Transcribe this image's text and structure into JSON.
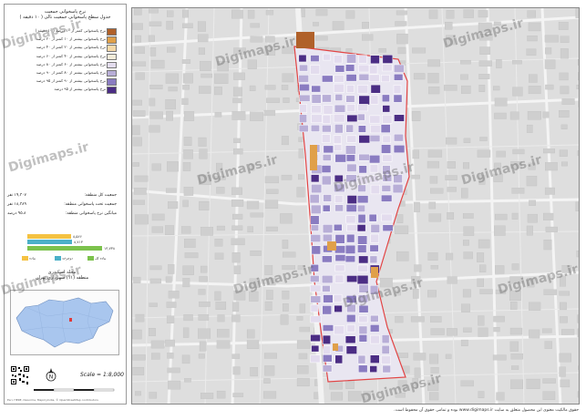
{
  "panel": {
    "title_line1": "نرخ پاسخوانی جمعیت",
    "title_line2": "جدول سطح پاسخوانی جمعیت نالی ( ۱۰ دقیقه )"
  },
  "legend": [
    {
      "label": "نرخ پاسخوانی کمتر از ۱۰ درصد ( ۱۰ دقیقه )",
      "color": "#b0612a"
    },
    {
      "label": "نرخ پاسخوانی بیشتر از ۱۰ کمتر از ۲۰ درصد",
      "color": "#e0a04a"
    },
    {
      "label": "نرخ پاسخوانی بیشتر از ۲۰ کمتر از ۴۰ درصد",
      "color": "#f5d9a8"
    },
    {
      "label": "نرخ پاسخوانی بیشتر از ۴۰ کمتر از ۶۰ درصد",
      "color": "#f3ecd9"
    },
    {
      "label": "نرخ پاسخوانی بیشتر از ۶۰ کمتر از ۸۰ درصد",
      "color": "#e3dcee"
    },
    {
      "label": "نرخ پاسخوانی بیشتر از ۸۰ کمتر از ۹۰ درصد",
      "color": "#b8aed7"
    },
    {
      "label": "نرخ پاسخوانی بیشتر از ۹۰ کمتر از ۹۵ درصد",
      "color": "#8a7cc1"
    },
    {
      "label": "نرخ پاسخوانی بیشتر از ۹۵ درصد",
      "color": "#4b2d84"
    }
  ],
  "info": [
    {
      "label": "جمعیت کل منطقه:",
      "value": "۱۹,۳۰۷ نفر"
    },
    {
      "label": "جمعیت تحت پاسخوانی منطقه:",
      "value": "۱۸,۳۸۹ نفر"
    },
    {
      "label": "میانگین نرخ پاسخوانی منطقه:",
      "value": "۹۵.۸ درصد"
    }
  ],
  "bars": [
    {
      "value": "۸,۵۶۶",
      "color": "#f5c242",
      "fraction": 0.48
    },
    {
      "value": "۸,۷۱۳",
      "color": "#4bb0c8",
      "fraction": 0.49
    },
    {
      "value": "۱۳,۷۳۸",
      "color": "#7cc24c",
      "fraction": 0.82
    }
  ],
  "mini_legend": [
    {
      "label": "پیاده",
      "color": "#f5c242"
    },
    {
      "label": "دوچرخه",
      "color": "#4bb0c8"
    },
    {
      "label": "پیاده کل",
      "color": "#7cc24c"
    }
  ],
  "region": {
    "line1": "محله اسکندری",
    "line2": "منطقه (۱۱) شهرداری تهران"
  },
  "scale_text": "Scale = 1:8,000",
  "north_label": "N",
  "footer_small": "Esri, HERE, DeLorme, MapmyIndia, © OpenStreetMap contributors",
  "watermark_text": "Digimaps.ir",
  "copyright": "حقوق مالکیت معنوی این محصول متعلق به سایت www.digimaps.ir بوده و تمامی حقوق آن محفوظ است."
}
